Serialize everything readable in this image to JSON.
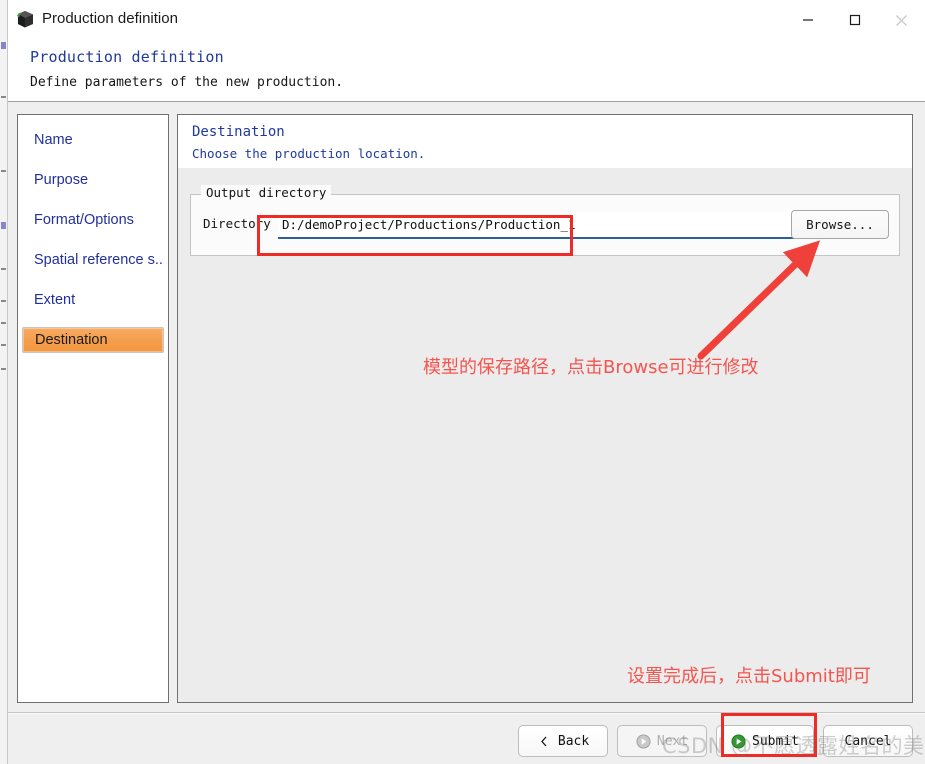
{
  "window": {
    "title": "Production definition",
    "icon": "cube-icon",
    "controls": {
      "minimize": "—",
      "maximize": "☐",
      "close": "✕"
    }
  },
  "header": {
    "title": "Production definition",
    "subtitle": "Define parameters of the new production."
  },
  "sidebar": {
    "items": [
      {
        "label": "Name",
        "name": "name",
        "active": false
      },
      {
        "label": "Purpose",
        "name": "purpose",
        "active": false
      },
      {
        "label": "Format/Options",
        "name": "format-options",
        "active": false
      },
      {
        "label": "Spatial reference s...",
        "name": "spatial-reference",
        "active": false
      },
      {
        "label": "Extent",
        "name": "extent",
        "active": false
      },
      {
        "label": "Destination",
        "name": "destination",
        "active": true
      }
    ]
  },
  "panel": {
    "title": "Destination",
    "subtitle": "Choose the production location.",
    "group_legend": "Output directory",
    "directory_label": "Directory",
    "directory_value": "D:/demoProject/Productions/Production_1",
    "directory_placeholder": "",
    "browse_label": "Browse..."
  },
  "annotations": [
    {
      "text": "模型的保存路径，点击Browse可进行修改",
      "name": "annotation-save-path"
    },
    {
      "text": "设置完成后，点击Submit即可",
      "name": "annotation-submit-hint"
    }
  ],
  "footer": {
    "buttons": [
      {
        "label": "Back",
        "name": "back",
        "icon": "chevron-left-icon",
        "disabled": false
      },
      {
        "label": "Next",
        "name": "next",
        "icon": "arrow-right-circle-gray-icon",
        "disabled": true
      },
      {
        "label": "Submit",
        "name": "submit",
        "icon": "arrow-right-circle-green-icon",
        "disabled": false
      },
      {
        "label": "Cancel",
        "name": "cancel",
        "icon": "",
        "disabled": false
      }
    ]
  },
  "watermark": "CSDN @不愿透露姓名的美女",
  "colors": {
    "accent_orange": "#f49d4c",
    "link_blue": "#203a9a",
    "annotation_red": "#f4554f",
    "highlight_red": "#ee2b26",
    "focus_underline": "#2a6099"
  }
}
